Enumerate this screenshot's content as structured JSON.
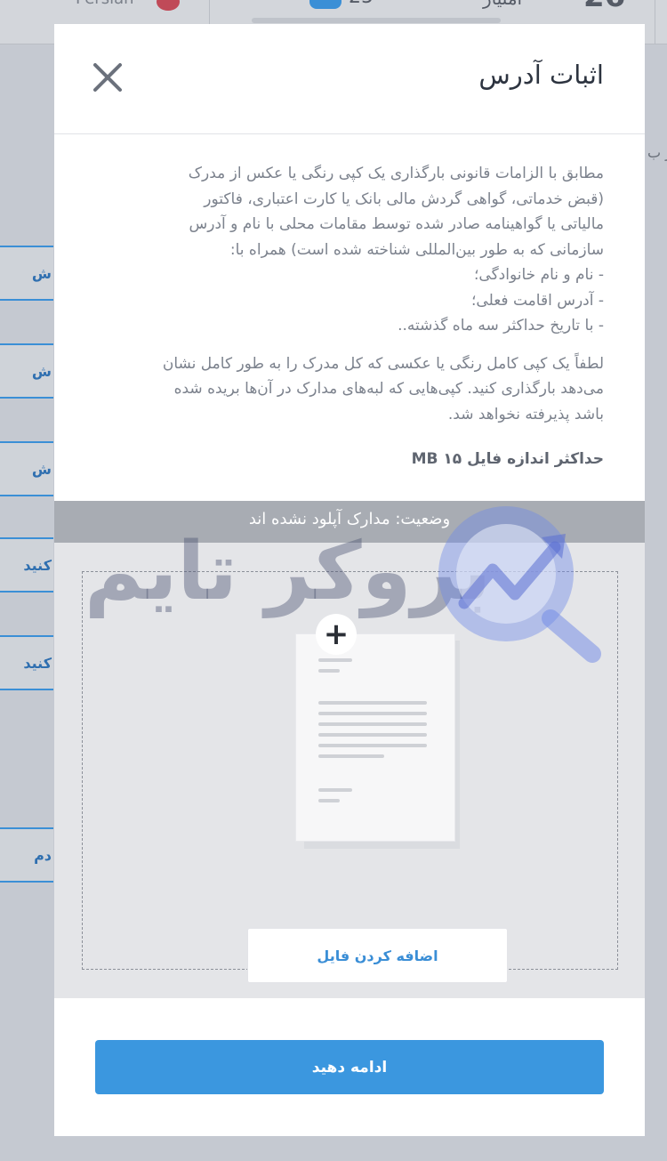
{
  "background": {
    "language_label": "Persian",
    "count_value": "25",
    "level_label": "امتیاز",
    "big_number": "26",
    "side_items": [
      "ش",
      "ش",
      "ش",
      "کنید",
      "کنید",
      "دم"
    ],
    "right_text": "ار ب"
  },
  "modal": {
    "title": "اثبات آدرس",
    "intro_lines": [
      "مطابق با الزامات قانونی بارگذاری یک کپی رنگی یا عکس از مدرک",
      "(قبض خدماتی، گواهی گردش مالی بانک یا کارت اعتباری، فاکتور",
      "مالیاتی یا گواهینامه صادر شده توسط مقامات محلی با نام و آدرس",
      "سازمانی که به طور بین‌المللی شناخته شده است) همراه با:",
      "- نام و نام خانوادگی؛",
      "- آدرس اقامت فعلی؛",
      "- با تاریخ حداکثر سه ماه گذشته.."
    ],
    "photo_lines": [
      "لطفاً یک کپی کامل رنگی یا عکسی که کل مدرک را به طور کامل نشان",
      "می‌دهد بارگذاری کنید. کپی‌هایی که لبه‌های مدارک در آن‌ها بریده شده",
      "باشد پذیرفته نخواهد شد."
    ],
    "max_file_size": "حداکثر اندازه فایل ۱۵ MB",
    "status": "وضعیت: مدارک آپلود نشده اند",
    "add_file_label": "اضافه کردن فایل",
    "continue_label": "ادامه دهید"
  },
  "watermark": {
    "text": "بروکر تایم"
  },
  "colors": {
    "accent": "#3b97df",
    "status_bar": "#a8acb3",
    "overlay": "#c5c9d1"
  },
  "icons": [
    "close-icon",
    "plus-icon",
    "document-icon"
  ]
}
